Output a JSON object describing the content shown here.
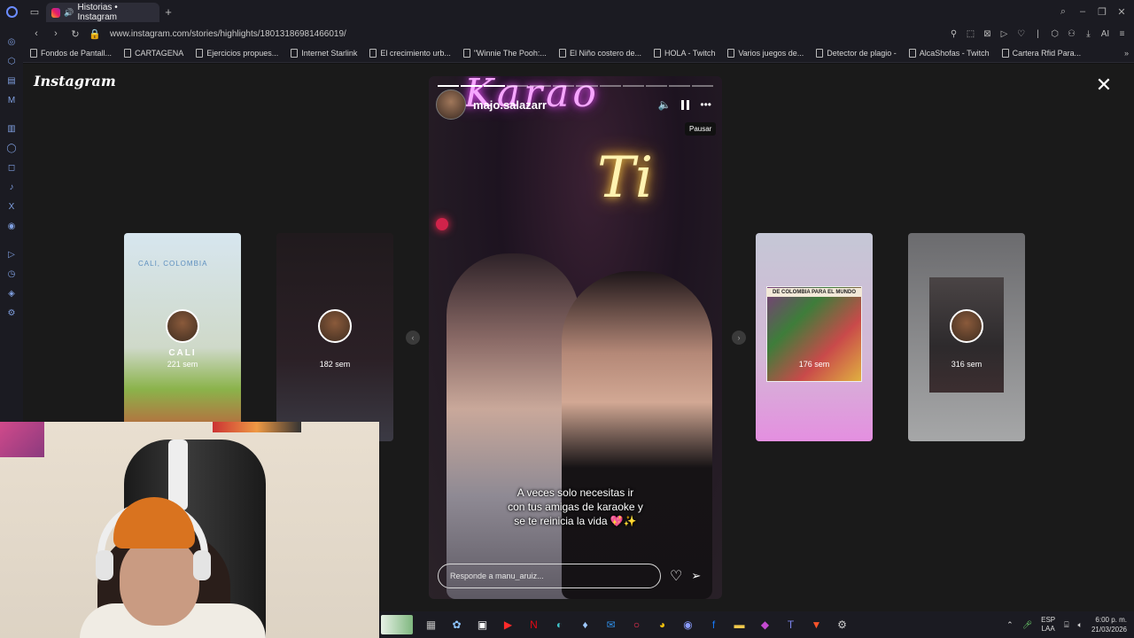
{
  "browser": {
    "tab": {
      "title": "Historias • Instagram"
    },
    "url": "www.instagram.com/stories/highlights/18013186981466019/",
    "bookmarks": [
      "Fondos de Pantall...",
      "CARTAGENA",
      "Ejercicios propues...",
      "Internet Starlink",
      "El crecimiento urb...",
      "\"Winnie The Pooh:...",
      "El Niño costero de...",
      "HOLA - Twitch",
      "Varios juegos de...",
      "Detector de plagio -",
      "AlcaShofas - Twitch",
      "Cartera Rfid Para..."
    ],
    "addr_ai_label": "AI"
  },
  "instagram": {
    "logo": "Instagram",
    "story": {
      "username": "majo.salazarr",
      "neon_text_1": "Karao",
      "neon_text_2": "Ti",
      "tooltip": "Pausar",
      "caption_lines": [
        "A veces solo necesitas ir",
        "con tus amigas de karaoke y",
        "se te reinicia la vida 💖✨"
      ],
      "reply_placeholder": "Responde a manu_aruiz...",
      "progress_total": 12,
      "progress_done": 3
    },
    "side_cards": [
      {
        "name": "CALI",
        "weeks": "221 sem",
        "tag": "CALI, COLOMBIA"
      },
      {
        "name": "",
        "weeks": "182 sem"
      },
      {
        "name": "",
        "weeks": "176 sem",
        "collage_title": "DE COLOMBIA PARA EL MUNDO"
      },
      {
        "name": "",
        "weeks": "316 sem"
      }
    ]
  },
  "taskbar": {
    "lang": [
      "ESP",
      "LAA"
    ],
    "time": "6:00 p. m.",
    "date": "21/03/2026"
  },
  "colors": {
    "neon_pink": "#f6a6ff",
    "neon_yellow": "#fff3b0",
    "viewer_bg": "#1a1a1a"
  }
}
